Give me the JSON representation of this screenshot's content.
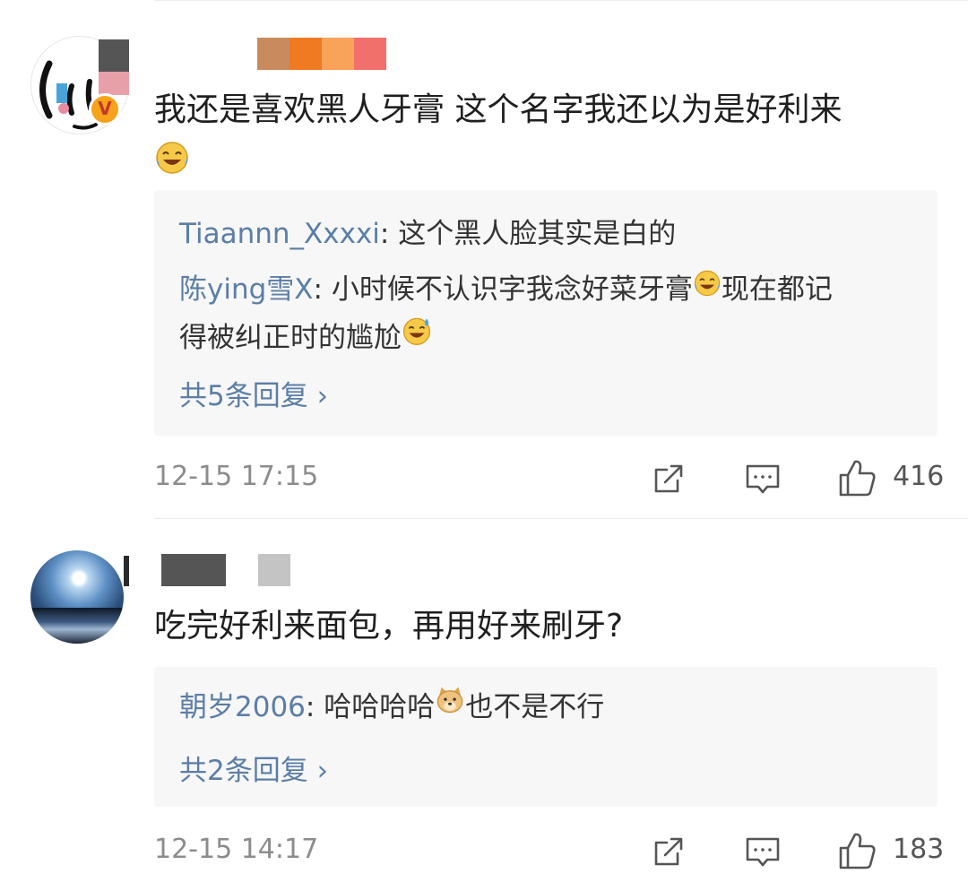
{
  "comments": [
    {
      "text": "我还是喜欢黑人牙膏 这个名字我还以为是好利来",
      "emoji": "laughing-crying-emoji",
      "avatar_badge": "V",
      "replies": [
        {
          "user": "Tiaannn_Xxxxi",
          "text": "这个黑人脸其实是白的"
        },
        {
          "user": "陈ying雪X",
          "text_before_emoji": "小时候不认识字我念好菜牙膏",
          "text_after_emoji": "现在都记",
          "text_line2": "得被纠正时的尴尬"
        }
      ],
      "more_replies": "共5条回复 ›",
      "time": "12-15 17:15",
      "likes": "416"
    },
    {
      "text": "吃完好利来面包，再用好来刷牙?",
      "replies": [
        {
          "user": "朝岁2006",
          "text_before_emoji": "哈哈哈哈",
          "text_after_emoji": "也不是不行"
        }
      ],
      "more_replies": "共2条回复 ›",
      "time": "12-15 14:17",
      "likes": "183"
    }
  ],
  "icons": [
    "share-icon",
    "comment-icon",
    "thumbs-up-icon"
  ],
  "colors": {
    "link": "#5b7ea6",
    "meta": "#8c8c8c",
    "reply_bg": "#f7f7f7",
    "badge": "#f7a21b"
  }
}
